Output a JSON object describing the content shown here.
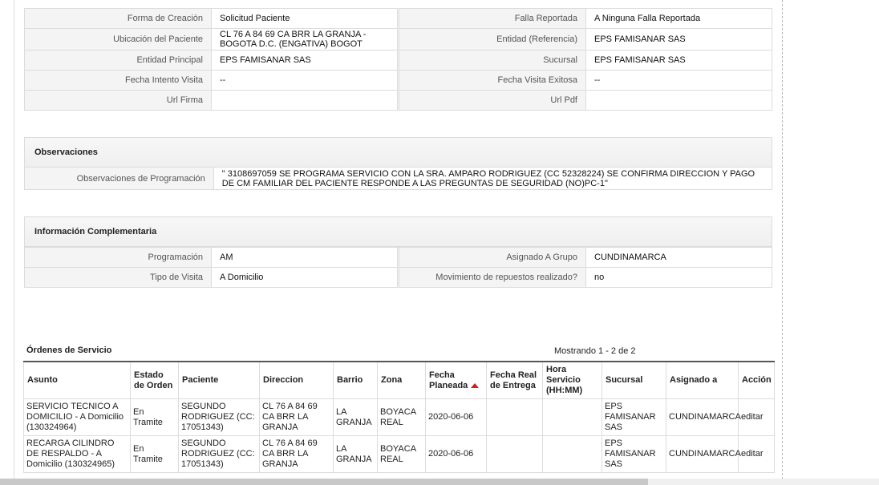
{
  "top_table": {
    "rows": [
      {
        "l1": "Forma de Creación",
        "v1": "Solicitud Paciente",
        "l2": "Falla Reportada",
        "v2": "A Ninguna Falla Reportada"
      },
      {
        "l1": "Ubicación del Paciente",
        "v1": "CL 76 A 84 69 CA BRR LA GRANJA - BOGOTA D.C. (ENGATIVA) BOGOT",
        "l2": "Entidad (Referencia)",
        "v2": "EPS FAMISANAR SAS"
      },
      {
        "l1": "Entidad Principal",
        "v1": "EPS FAMISANAR SAS",
        "l2": "Sucursal",
        "v2": "EPS FAMISANAR SAS"
      },
      {
        "l1": "Fecha Intento Visita",
        "v1": "--",
        "l2": "Fecha Visita Exitosa",
        "v2": "--"
      },
      {
        "l1": "Url Firma",
        "v1": "",
        "l2": "Url Pdf",
        "v2": ""
      }
    ]
  },
  "observaciones": {
    "title": "Observaciones",
    "label": "Observaciones de Programación",
    "value": "\" 3108697059 SE PROGRAMA SERVICIO CON LA SRA. AMPARO RODRIGUEZ (CC 52328224) SE CONFIRMA DIRECCION Y PAGO DE CM FAMILIAR DEL PACIENTE RESPONDE A LAS PREGUNTAS DE SEGURIDAD (NO)PC-1\""
  },
  "complementaria": {
    "title": "Información Complementaria",
    "rows": [
      {
        "l1": "Programación",
        "v1": "AM",
        "l2": "Asignado A Grupo",
        "v2": "CUNDINAMARCA"
      },
      {
        "l1": "Tipo de Visita",
        "v1": "A Domicilio",
        "l2": "Movimiento de repuestos realizado?",
        "v2": "no"
      }
    ]
  },
  "orders": {
    "title": "Órdenes de Servicio",
    "count": "Mostrando 1 - 2 de 2",
    "headers": [
      "Asunto",
      "Estado de Orden",
      "Paciente",
      "Direccion",
      "Barrio",
      "Zona",
      "Fecha Planeada",
      "Fecha Real de Entrega",
      "Hora Servicio (HH:MM)",
      "Sucursal",
      "Asignado a",
      "Acción"
    ],
    "rows": [
      {
        "asunto": "SERVICIO TECNICO A DOMICILIO - A Domicilio (130324964)",
        "estado": "En Tramite",
        "paciente": "SEGUNDO RODRIGUEZ (CC: 17051343)",
        "direccion": "CL 76 A 84 69 CA BRR LA GRANJA",
        "barrio": "LA GRANJA",
        "zona": "BOYACA REAL",
        "fecha_planeada": "2020-06-06",
        "fecha_real": "",
        "hora": "",
        "sucursal": "EPS FAMISANAR SAS",
        "asignado": "CUNDINAMARCA",
        "accion": "editar"
      },
      {
        "asunto": "RECARGA CILINDRO DE RESPALDO - A Domicilio (130324965)",
        "estado": "En Tramite",
        "paciente": "SEGUNDO RODRIGUEZ (CC: 17051343)",
        "direccion": "CL 76 A 84 69 CA BRR LA GRANJA",
        "barrio": "LA GRANJA",
        "zona": "BOYACA REAL",
        "fecha_planeada": "2020-06-06",
        "fecha_real": "",
        "hora": "",
        "sucursal": "EPS FAMISANAR SAS",
        "asignado": "CUNDINAMARCA",
        "accion": "editar"
      }
    ]
  }
}
